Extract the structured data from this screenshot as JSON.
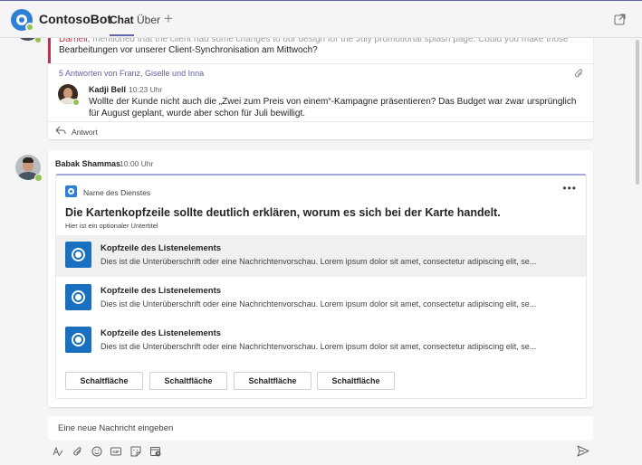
{
  "header": {
    "app_name": "ContosoBot",
    "tabs": [
      {
        "label": "Chat",
        "selected": true
      },
      {
        "label": "Über",
        "selected": false
      }
    ]
  },
  "thread": {
    "message_text_line1_faded": "mentioned that the client had some changes to our design for the July promotional splash page. Could you make those",
    "message_text_line1_highlight": "Darnell,",
    "message_text_line2": "Bearbeitungen vor unserer Client-Synchronisation am Mittwoch?",
    "replies_summary": "5 Antworten von Franz, Giselle und Inna",
    "reply": {
      "author": "Kadji Bell",
      "time": "10:23 Uhr",
      "text": "Wollte der Kunde nicht auch die „Zwei zum Preis von einem“-Kampagne präsentieren? Das Budget war zwar ursprünglich für August geplant, wurde aber schon für Juli bewilligt."
    },
    "reply_action_label": "Antwort"
  },
  "message": {
    "author": "Babak Shammas",
    "time": "10:00 Uhr"
  },
  "card": {
    "service_name": "Name des Dienstes",
    "more_label": "•••",
    "title": "Die Kartenkopfzeile sollte deutlich erklären, worum es sich bei der Karte handelt.",
    "subtitle": "Hier ist ein optionaler Untertitel",
    "items": [
      {
        "title": "Kopfzeile des Listenelements",
        "subtitle": "Dies ist die Unterüberschrift oder eine Nachrichtenvorschau. Lorem ipsum dolor sit amet, consectetur adipiscing elit, se...",
        "selected": true
      },
      {
        "title": "Kopfzeile des Listenelements",
        "subtitle": "Dies ist die Unterüberschrift oder eine Nachrichtenvorschau. Lorem ipsum dolor sit amet, consectetur adipiscing elit, se...",
        "selected": false
      },
      {
        "title": "Kopfzeile des Listenelements",
        "subtitle": "Dies ist die Unterüberschrift oder eine Nachrichtenvorschau. Lorem ipsum dolor sit amet, consectetur adipiscing elit, se...",
        "selected": false
      }
    ],
    "buttons": [
      "Schaltfläche",
      "Schaltfläche",
      "Schaltfläche",
      "Schaltfläche"
    ]
  },
  "compose": {
    "placeholder": "Eine neue Nachricht eingeben",
    "toolbar_icons": [
      "format-icon",
      "attach-icon",
      "emoji-icon",
      "gif-icon",
      "sticker-icon",
      "schedule-meeting-icon"
    ],
    "gif_label": "GIF"
  },
  "colors": {
    "brand": "#6264a7",
    "status_available": "#92c353",
    "mention_red": "#c4314b",
    "app_blue": "#2f7fd3"
  }
}
